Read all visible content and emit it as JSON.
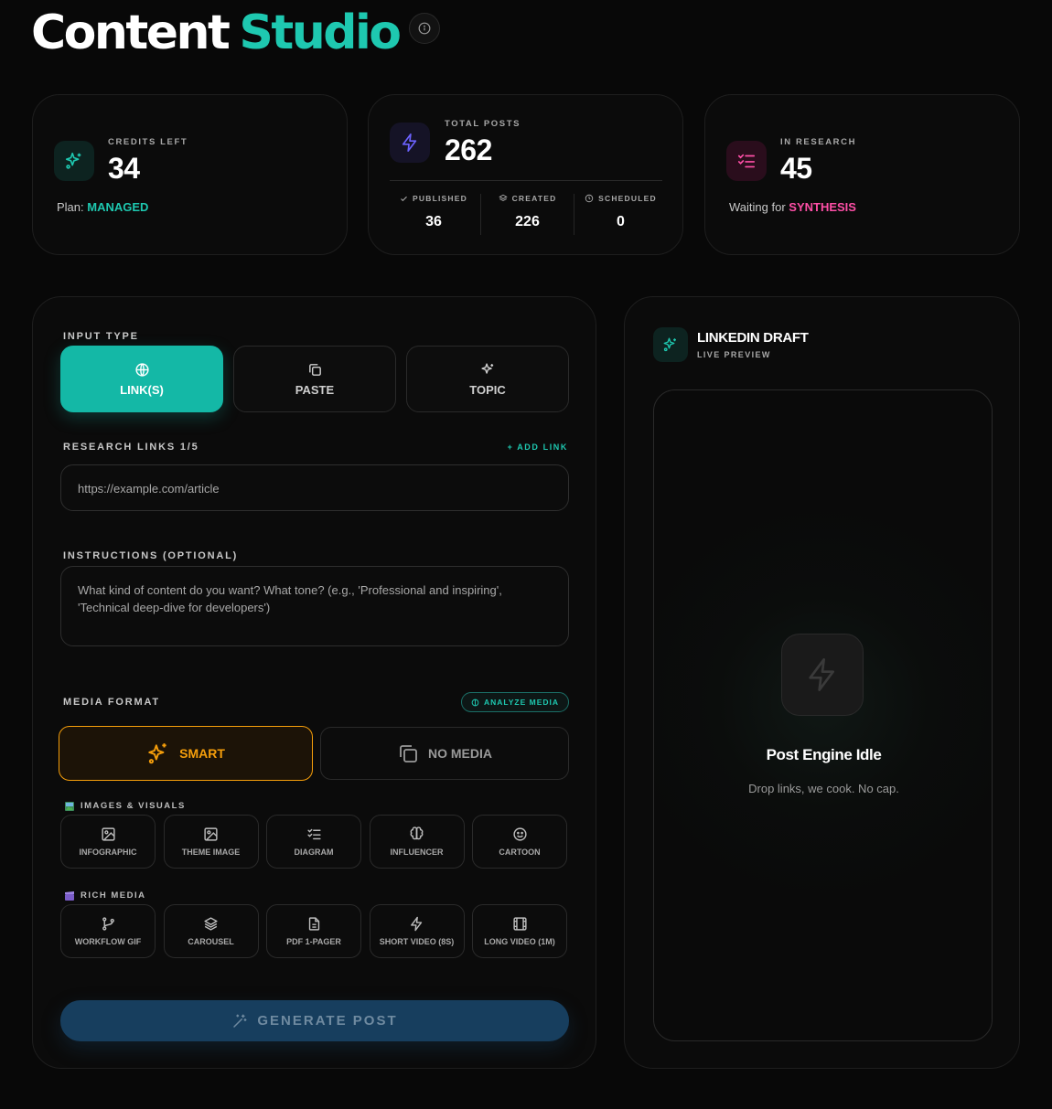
{
  "header": {
    "title_part1": "Content",
    "title_part2": "Studio"
  },
  "stats": {
    "credits": {
      "label": "CREDITS LEFT",
      "value": "34",
      "plan_prefix": "Plan:",
      "plan": "MANAGED"
    },
    "total": {
      "label": "TOTAL POSTS",
      "value": "262",
      "published_label": "PUBLISHED",
      "published": "36",
      "created_label": "CREATED",
      "created": "226",
      "scheduled_label": "SCHEDULED",
      "scheduled": "0"
    },
    "research": {
      "label": "IN RESEARCH",
      "value": "45",
      "waiting_prefix": "Waiting for",
      "waiting": "SYNTHESIS"
    }
  },
  "form": {
    "input_type_label": "INPUT TYPE",
    "input_types": [
      "LINK(S)",
      "PASTE",
      "TOPIC"
    ],
    "research_links_label": "RESEARCH LINKS 1/5",
    "add_link": "+ ADD LINK",
    "link_placeholder": "https://example.com/article",
    "instructions_label": "INSTRUCTIONS (OPTIONAL)",
    "instructions_placeholder": "What kind of content do you want? What tone? (e.g., 'Professional and inspiring', 'Technical deep-dive for developers')",
    "media_format_label": "MEDIA FORMAT",
    "analyze_media": "ANALYZE MEDIA",
    "smart": "SMART",
    "no_media": "NO MEDIA",
    "images_label": "IMAGES & VISUALS",
    "images": [
      "INFOGRAPHIC",
      "THEME IMAGE",
      "DIAGRAM",
      "INFLUENCER",
      "CARTOON"
    ],
    "rich_label": "RICH MEDIA",
    "rich": [
      "WORKFLOW GIF",
      "CAROUSEL",
      "PDF 1-PAGER",
      "SHORT VIDEO (8S)",
      "LONG VIDEO (1M)"
    ],
    "generate": "GENERATE POST"
  },
  "preview": {
    "title": "LINKEDIN DRAFT",
    "subtitle": "LIVE PREVIEW",
    "idle_title": "Post Engine Idle",
    "idle_sub": "Drop links, we cook. No cap."
  },
  "colors": {
    "accent_teal": "#1ec8b0",
    "accent_pink": "#ff4fa7",
    "accent_amber": "#f59e0b",
    "generate_bg": "#173e5e"
  }
}
